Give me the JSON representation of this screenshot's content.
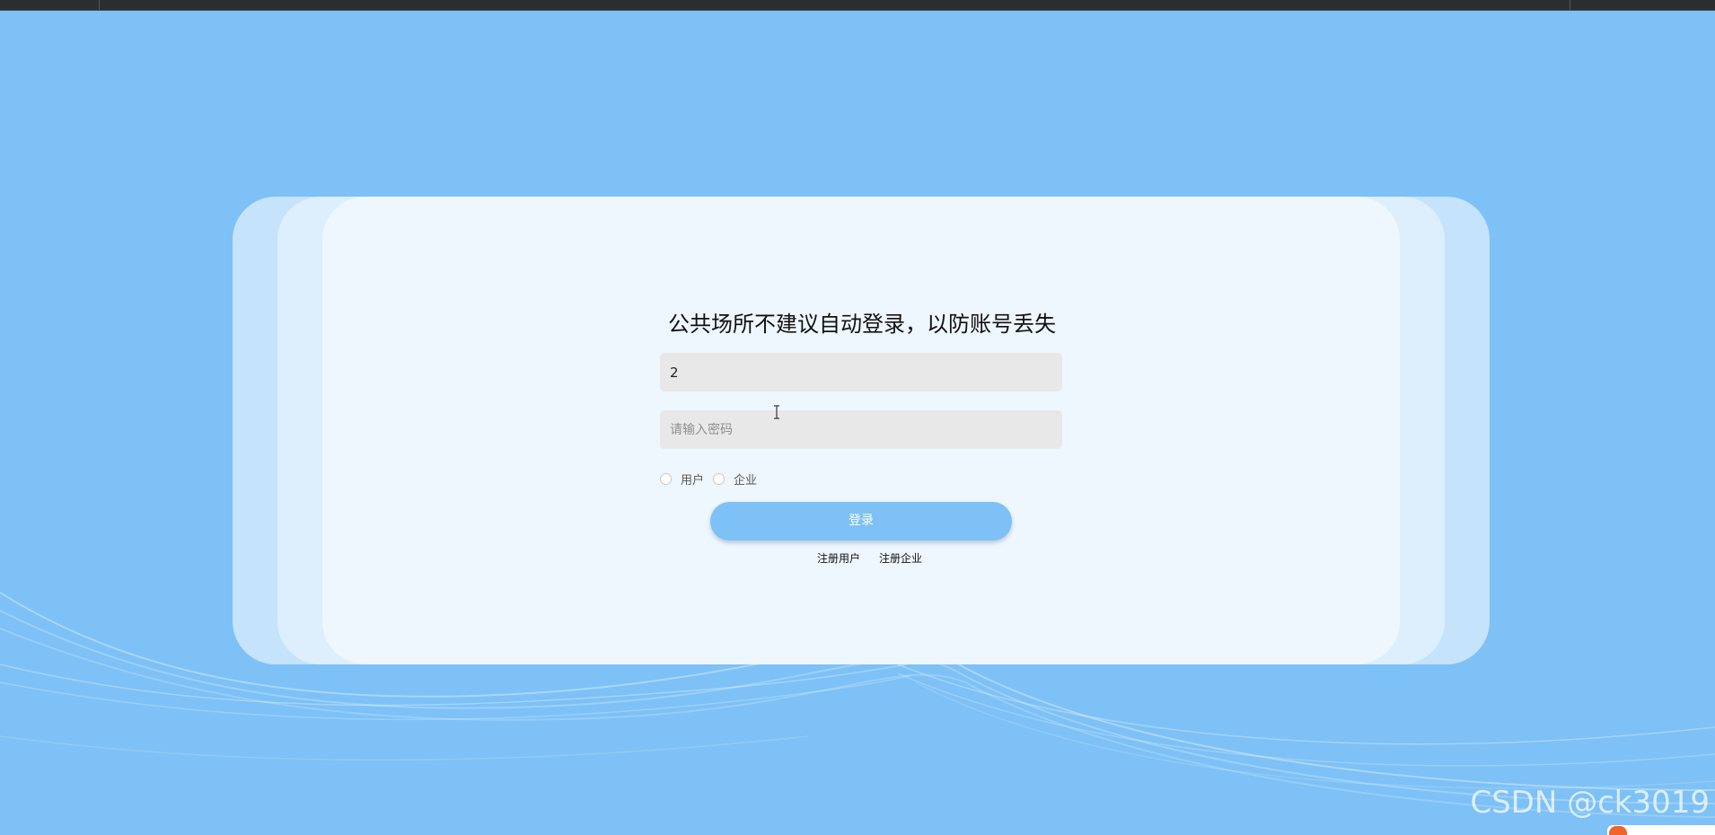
{
  "login": {
    "title": "公共场所不建议自动登录，以防账号丢失",
    "username_value": "2",
    "password_placeholder": "请输入密码",
    "roles": [
      {
        "label": "用户",
        "checked": false
      },
      {
        "label": "企业",
        "checked": false
      }
    ],
    "submit_label": "登录",
    "register_user_label": "注册用户",
    "register_company_label": "注册企业"
  },
  "watermark": "CSDN @ck3019",
  "colors": {
    "background": "#7dc1f6",
    "card_outer": "#c5e3fb",
    "card_middle": "#ddeffc",
    "card_inner": "#eef7fe",
    "input_bg": "#e8e8e8",
    "button_bg": "#7dc1f6"
  }
}
